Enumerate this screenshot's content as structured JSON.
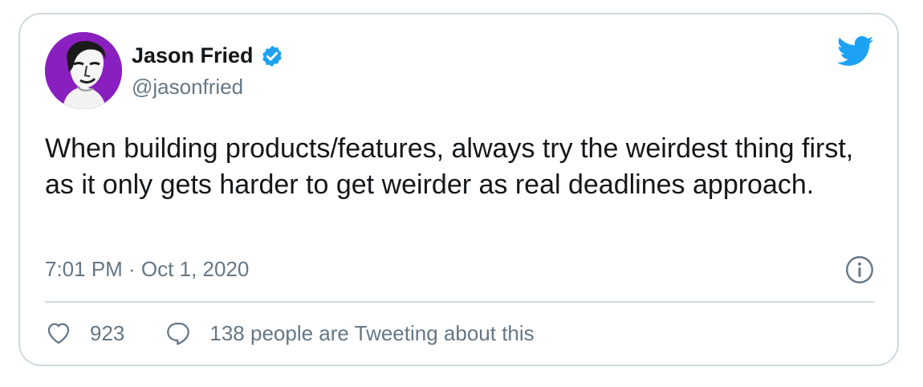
{
  "tweet": {
    "author": {
      "name": "Jason Fried",
      "handle": "@jasonfried",
      "avatar_bg": "#8a1fbf"
    },
    "brand_icon": "twitter-bird-icon",
    "brand_color": "#1da1f2",
    "text": "When building products/features, always try the weirdest thing first, as it only gets harder to get weirder as real deadlines approach.",
    "timestamp": "7:01 PM · Oct 1, 2020",
    "likes": "923",
    "tweeting_about": "138 people are Tweeting about this"
  }
}
